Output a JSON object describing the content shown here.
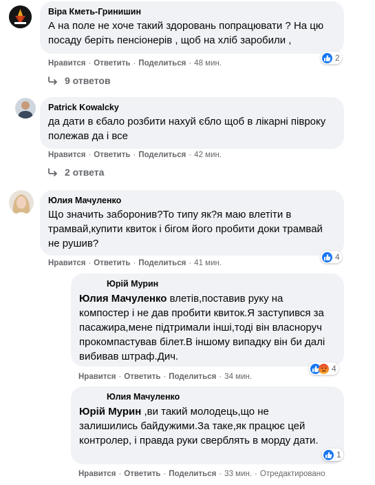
{
  "labels": {
    "like": "Нравится",
    "reply": "Ответить",
    "share": "Поделиться"
  },
  "comments": [
    {
      "author": "Віра Кметь-Гринишин",
      "text": "А на поле не хоче такий здоровань попрацювати ? На цю посаду беріть пенсіонерів , щоб на хліб заробили ,",
      "time": "48 мин.",
      "reactions": "2",
      "replies_label": "9 ответов"
    },
    {
      "author": "Patrick Kowalcky",
      "text": "да дати в єбало розбити нахуй єбло щоб в лікарні півроку полежав да і все",
      "time": "42 мин.",
      "replies_label": "2 ответа"
    },
    {
      "author": "Юлия Мачуленко",
      "text": "Що значить заборонив?То типу як?я маю влетіти в трамвай,купити квиток і бігом його пробити доки трамвай не рушив?",
      "time": "41 мин.",
      "reactions": "4"
    }
  ],
  "replies": [
    {
      "author": "Юрій Мурин",
      "mention": "Юлия Мачуленко",
      "text": " влетів,поставив руку на компостер і не дав пробити квиток.Я заступився за пасажира,мене підтримали інші,тоді він власноруч прокомпастував білет.В іншому випадку він би далі вибивав штраф.Дич.",
      "time": "34 мин.",
      "reactions": "4"
    },
    {
      "author": "Юлия Мачуленко",
      "mention": "Юрій Мурин",
      "text": " ,ви такий молодець,що не залишились байдужими.За таке,як працює цей контролер, і правда руки сверблять в морду дати.",
      "time": "33 мин.",
      "edited": "Отредактировано",
      "reactions": "1"
    }
  ]
}
